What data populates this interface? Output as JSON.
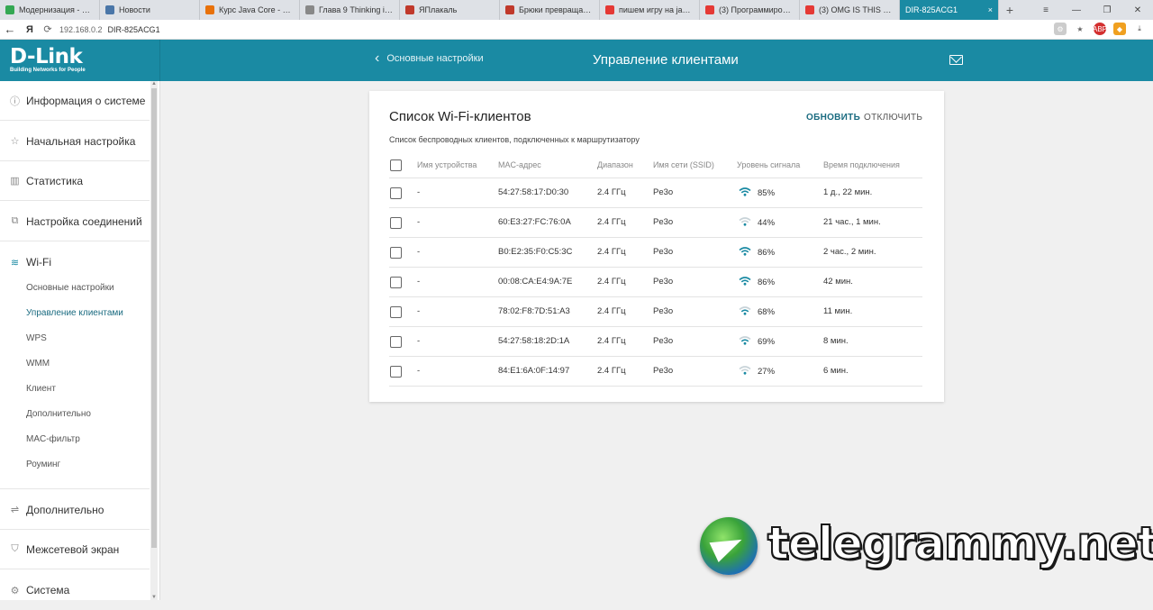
{
  "browser": {
    "tabs": [
      {
        "label": "Модернизация - Goo",
        "color": "#34a853"
      },
      {
        "label": "Новости",
        "color": "#4a76a8"
      },
      {
        "label": "Курс Java Core - Лекц",
        "color": "#e8710a"
      },
      {
        "label": "Глава 9 Thinking in Ja",
        "color": "#888888"
      },
      {
        "label": "ЯПлакаль",
        "color": "#c0392b"
      },
      {
        "label": "Брюки превращаются",
        "color": "#c0392b"
      },
      {
        "label": "пишем игру на java -",
        "color": "#e53935"
      },
      {
        "label": "(3) Программирован",
        "color": "#e53935"
      },
      {
        "label": "(3) OMG IS THIS DOTA",
        "color": "#e53935"
      }
    ],
    "active_tab": {
      "label": "DIR-825ACG1",
      "close": "×"
    },
    "new_tab": "+",
    "window_controls": [
      "≡",
      "—",
      "❐",
      "✕"
    ],
    "address": {
      "back": "←",
      "yandex": "Я",
      "host": "192.168.0.2",
      "title": "DIR-825ACG1"
    },
    "right_icons": [
      "gear-icon",
      "star-icon",
      "adblock-icon",
      "extension-icon",
      "download-icon"
    ]
  },
  "header": {
    "logo": "D-Link",
    "logo_sub": "Building Networks for People",
    "back_label": "Основные настройки",
    "title": "Управление клиентами"
  },
  "sidebar": {
    "items": [
      {
        "label": "Информация о системе",
        "icon": "info-icon"
      },
      {
        "label": "Начальная настройка",
        "icon": "star-icon"
      },
      {
        "label": "Статистика",
        "icon": "chart-icon"
      },
      {
        "label": "Настройка соединений",
        "icon": "network-icon"
      },
      {
        "label": "Wi-Fi",
        "icon": "wifi-icon"
      }
    ],
    "wifi_sub": [
      {
        "label": "Основные настройки",
        "active": false
      },
      {
        "label": "Управление клиентами",
        "active": true
      },
      {
        "label": "WPS",
        "active": false
      },
      {
        "label": "WMM",
        "active": false
      },
      {
        "label": "Клиент",
        "active": false
      },
      {
        "label": "Дополнительно",
        "active": false
      },
      {
        "label": "MAC-фильтр",
        "active": false
      },
      {
        "label": "Роуминг",
        "active": false
      }
    ],
    "bottom_items": [
      {
        "label": "Дополнительно",
        "icon": "sliders-icon"
      },
      {
        "label": "Межсетевой экран",
        "icon": "shield-icon"
      },
      {
        "label": "Система",
        "icon": "gear-icon"
      }
    ]
  },
  "card": {
    "title": "Список Wi-Fi-клиентов",
    "refresh_label": "ОБНОВИТЬ",
    "disconnect_label": "ОТКЛЮЧИТЬ",
    "description": "Список беспроводных клиентов, подключенных к маршрутизатору",
    "columns": [
      "Имя устройства",
      "MAC-адрес",
      "Диапазон",
      "Имя сети (SSID)",
      "Уровень сигнала",
      "Время подключения"
    ],
    "rows": [
      {
        "name": "-",
        "mac": "54:27:58:17:D0:30",
        "band": "2.4 ГГц",
        "ssid": "Pe3o",
        "signal": 85,
        "signal_text": "85%",
        "time": "1 д., 22 мин."
      },
      {
        "name": "-",
        "mac": "60:E3:27:FC:76:0A",
        "band": "2.4 ГГц",
        "ssid": "Pe3o",
        "signal": 44,
        "signal_text": "44%",
        "time": "21 час., 1 мин."
      },
      {
        "name": "-",
        "mac": "B0:E2:35:F0:C5:3C",
        "band": "2.4 ГГц",
        "ssid": "Pe3o",
        "signal": 86,
        "signal_text": "86%",
        "time": "2 час., 2 мин."
      },
      {
        "name": "-",
        "mac": "00:08:CA:E4:9A:7E",
        "band": "2.4 ГГц",
        "ssid": "Pe3o",
        "signal": 86,
        "signal_text": "86%",
        "time": "42 мин."
      },
      {
        "name": "-",
        "mac": "78:02:F8:7D:51:A3",
        "band": "2.4 ГГц",
        "ssid": "Pe3o",
        "signal": 68,
        "signal_text": "68%",
        "time": "11 мин."
      },
      {
        "name": "-",
        "mac": "54:27:58:18:2D:1A",
        "band": "2.4 ГГц",
        "ssid": "Pe3o",
        "signal": 69,
        "signal_text": "69%",
        "time": "8 мин."
      },
      {
        "name": "-",
        "mac": "84:E1:6A:0F:14:97",
        "band": "2.4 ГГц",
        "ssid": "Pe3o",
        "signal": 27,
        "signal_text": "27%",
        "time": "6 мин."
      }
    ]
  },
  "watermark": {
    "text": "telegrammy.net"
  },
  "colors": {
    "accent": "#1a8aa3",
    "active_link": "#1a6b80",
    "wifi_strong": "#1a8aa3",
    "wifi_weak": "#9ab"
  }
}
